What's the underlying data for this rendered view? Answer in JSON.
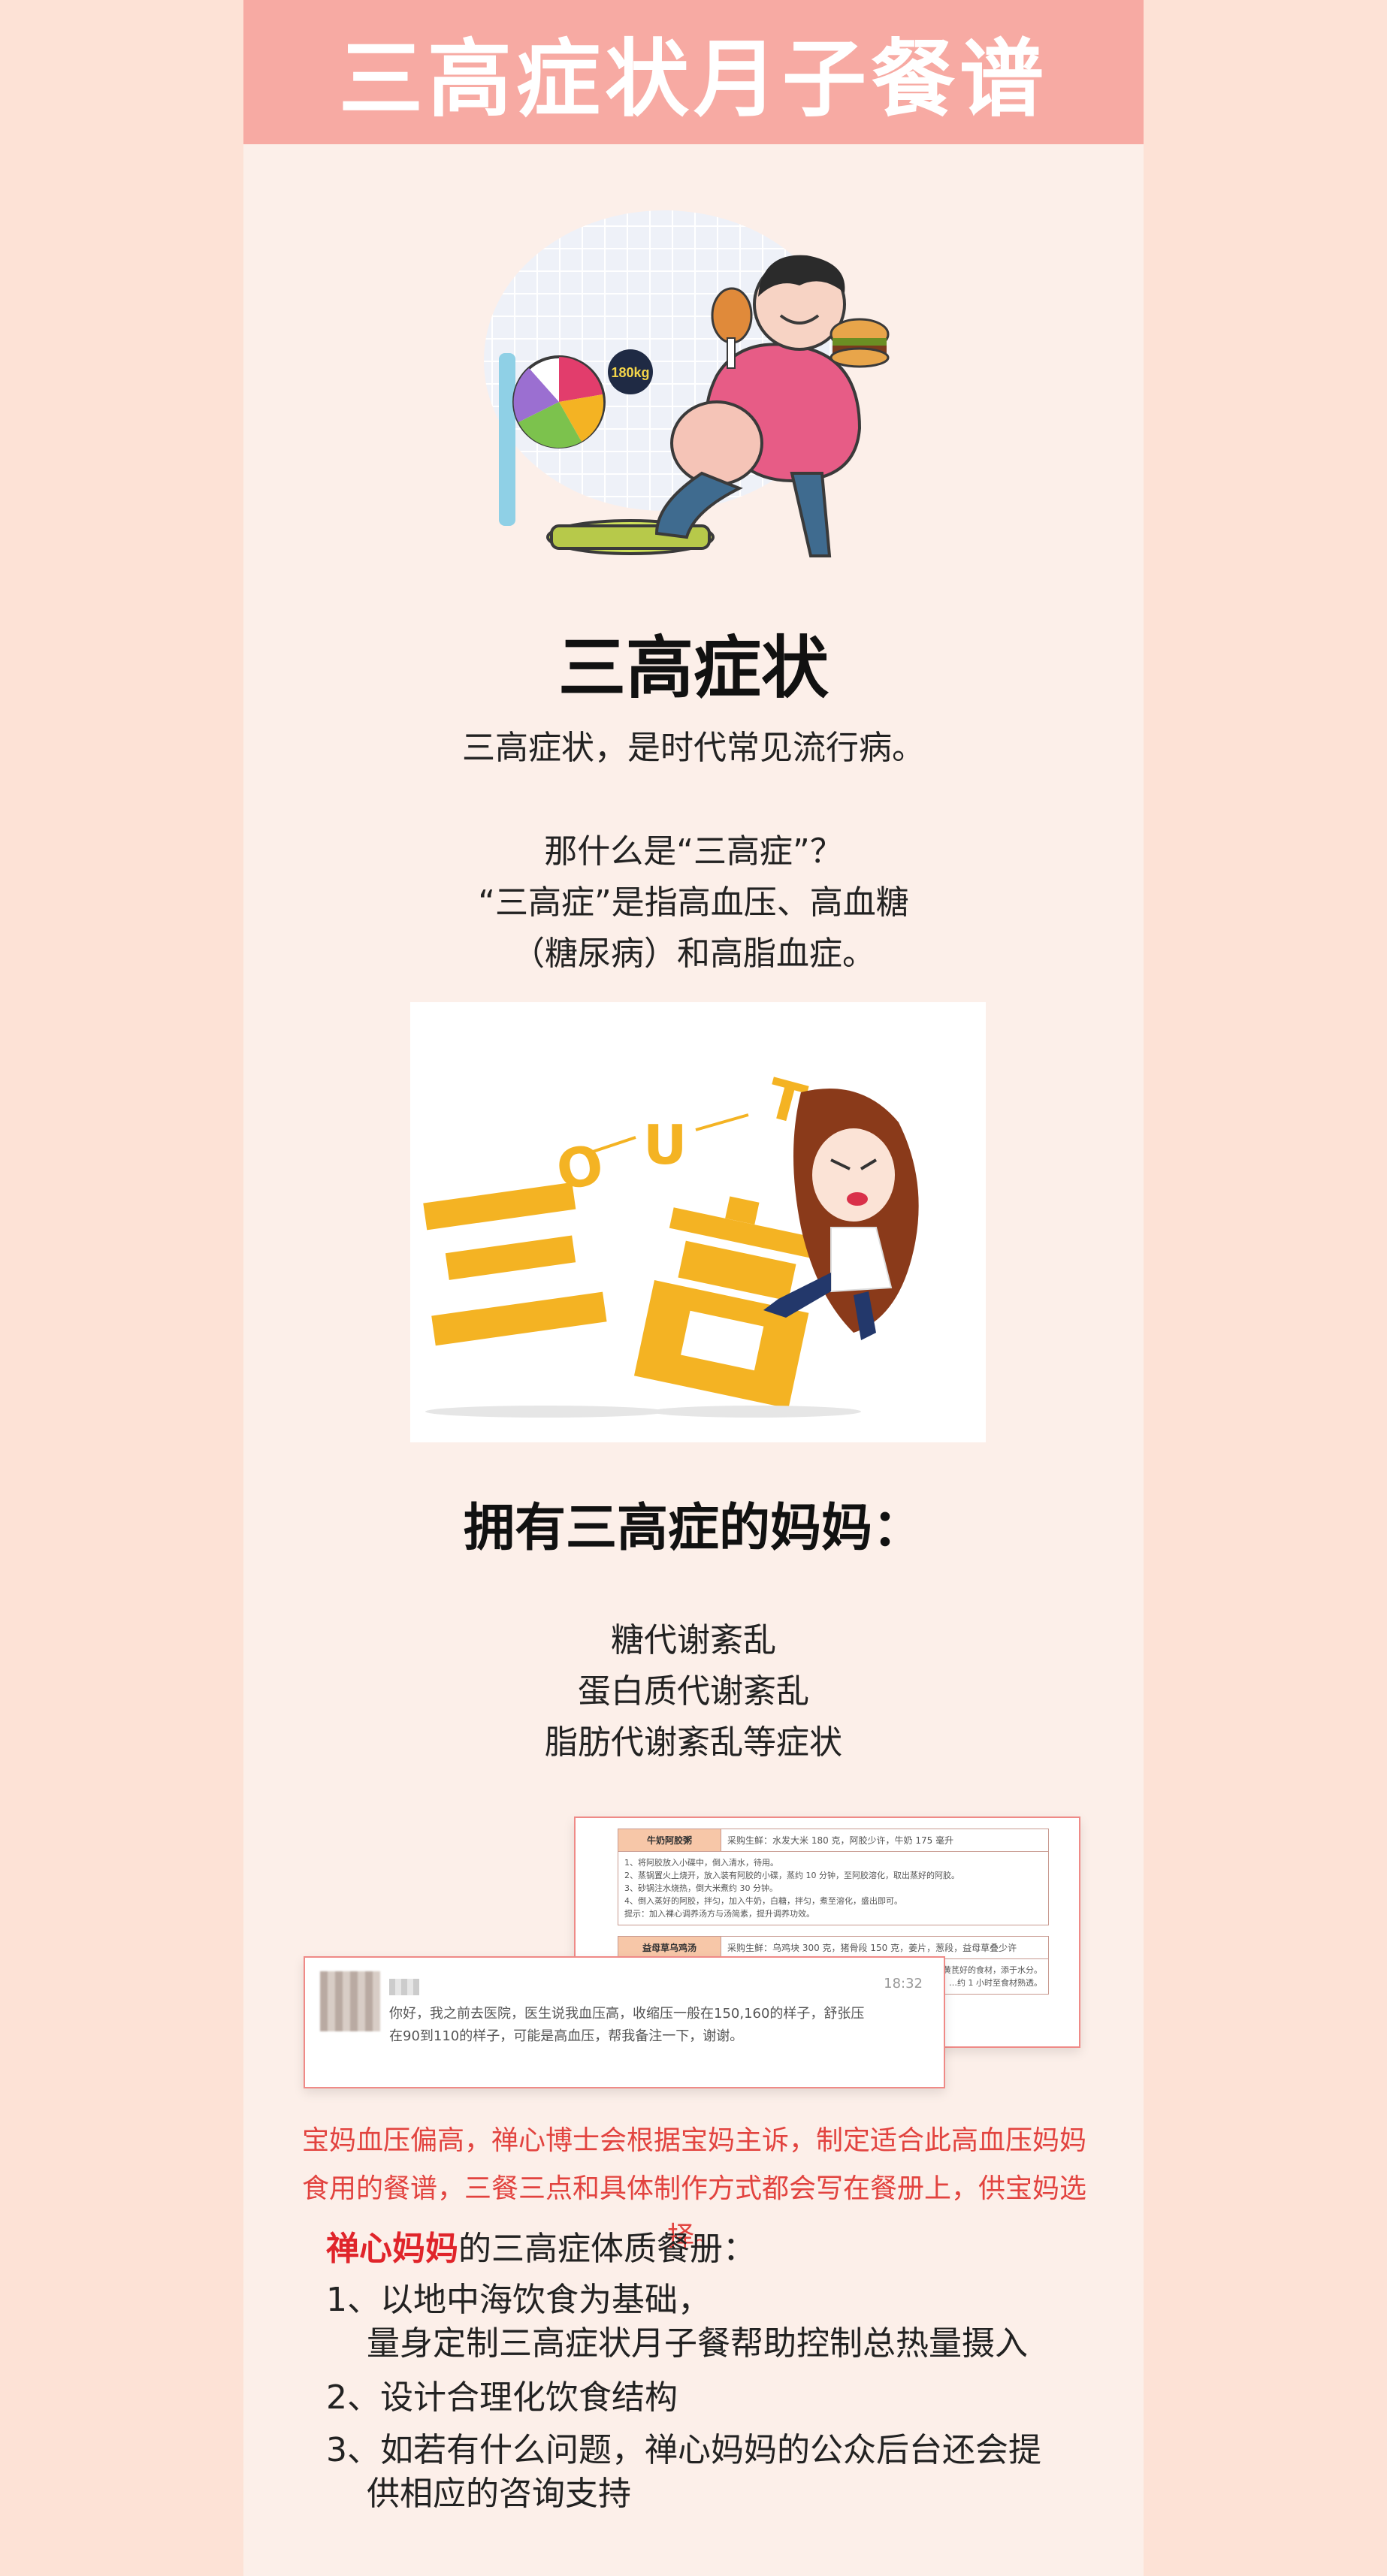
{
  "banner": {
    "title": "三高症状月子餐谱"
  },
  "section1": {
    "heading": "三高症状",
    "lines": [
      "三高症状，是时代常见流行病。",
      "那什么是“三高症”？",
      "“三高症”是指高血压、高血糖",
      "（糖尿病）和高脂血症。"
    ]
  },
  "illustration1": {
    "scale_label": "180kg"
  },
  "illustration2": {
    "letters": [
      "O",
      "U",
      "T"
    ]
  },
  "section2": {
    "heading": "拥有三高症的妈妈：",
    "lines": [
      "糖代谢紊乱",
      "蛋白质代谢紊乱",
      "脂肪代谢紊乱等症状"
    ]
  },
  "chat_card": {
    "time": "18:32",
    "message": "你好，我之前去医院，医生说我血压高，收缩压一般在150,160的样子，舒张压在90到110的样子，可能是高血压，帮我备注一下，谢谢。"
  },
  "recipe_card": {
    "dish1_name": "牛奶阿胶粥",
    "dish1_ingredients": "采购生鲜：水发大米 180 克，阿胶少许，牛奶 175 毫升",
    "dish1_steps": [
      "1、将阿胶放入小碟中，倒入清水，待用。",
      "2、蒸锅置火上烧开，放入装有阿胶的小碟，蒸约 10 分钟，至阿胶溶化，取出蒸好的阿胶。",
      "3、砂锅注水烧热，倒大米煮约 30 分钟。",
      "4、倒入蒸好的阿胶，拌匀，加入牛奶，白糖，拌匀，煮至溶化，盛出即可。",
      "提示：加入裸心调养汤方与汤简素，提升调养功效。"
    ],
    "dish2_name": "益母草乌鸡汤",
    "dish2_ingredients": "采购生鲜：乌鸡块 300 克，猪骨段 150 克，姜片，葱段，益母草叠少许",
    "dish2_steps": [
      "…黄芪好的食材，添于水分。",
      "…约 1 小时至食材熟透。"
    ]
  },
  "red_note": "宝妈血压偏高，禅心博士会根据宝妈主诉，制定适合此高血压妈妈食用的餐谱，三餐三点和具体制作方式都会写在餐册上，供宝妈选择。",
  "menu": {
    "brand": "禅心妈妈",
    "connector": "的",
    "title": "三高症体质餐册：",
    "items": [
      {
        "num": "1、",
        "text": "以地中海饮食为基础，",
        "cont": "量身定制三高症状月子餐帮助控制总热量摄入"
      },
      {
        "num": "2、",
        "text": "设计合理化饮食结构",
        "cont": ""
      },
      {
        "num": "3、",
        "text": "如若有什么问题，禅心妈妈的公众后台还会提",
        "cont": "供相应的咨询支持"
      }
    ]
  },
  "colors": {
    "page_bg": "#fde2d6",
    "column_bg": "#fcefe9",
    "banner": "#f7aaa3",
    "accent_red": "#e0242a",
    "note_red": "#e2433f",
    "illus_yellow": "#f4b323"
  }
}
